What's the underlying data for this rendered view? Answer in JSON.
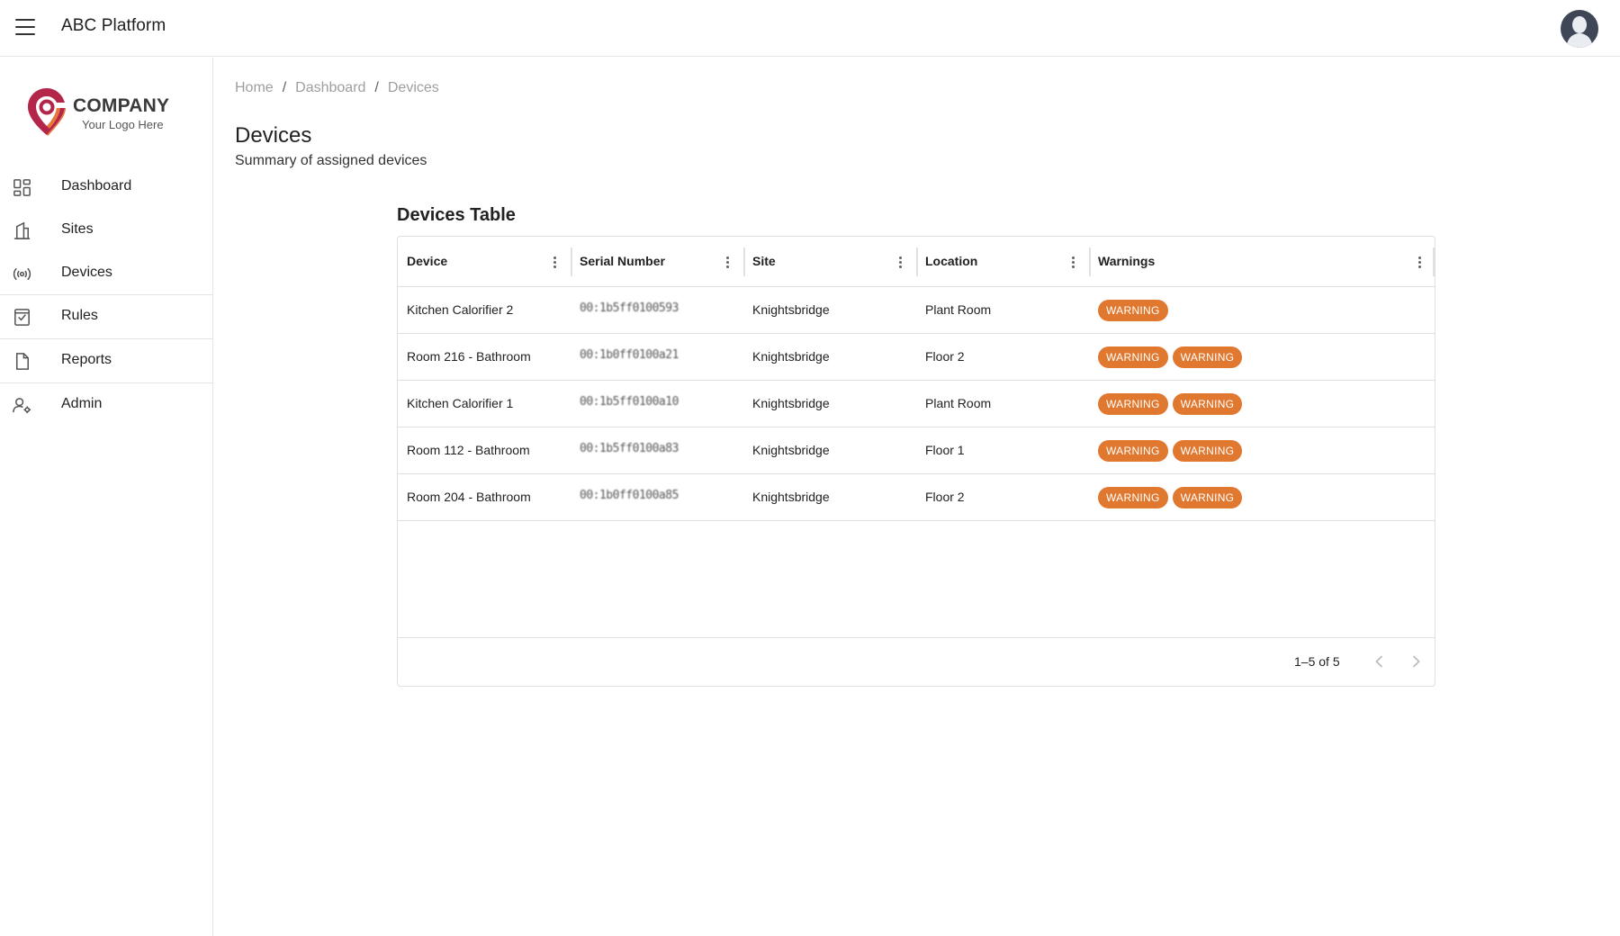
{
  "app": {
    "title": "ABC Platform",
    "menu_icon": "hamburger-menu-icon",
    "avatar_icon": "user-avatar-icon"
  },
  "logo": {
    "wordmark": "COMPANY",
    "tagline": "Your Logo Here",
    "colors": {
      "primary": "#b3264a",
      "secondary": "#e8773a"
    }
  },
  "sidebar": {
    "items": [
      {
        "label": "Dashboard",
        "icon": "dashboard-grid-icon"
      },
      {
        "label": "Sites",
        "icon": "building-icon"
      },
      {
        "label": "Devices",
        "icon": "broadcast-signal-icon"
      },
      {
        "label": "Rules",
        "icon": "checklist-icon"
      },
      {
        "label": "Reports",
        "icon": "document-icon"
      },
      {
        "label": "Admin",
        "icon": "user-settings-icon"
      }
    ]
  },
  "breadcrumb": {
    "items": [
      "Home",
      "Dashboard",
      "Devices"
    ],
    "separator": "/"
  },
  "page": {
    "title": "Devices",
    "subtitle": "Summary of assigned devices"
  },
  "table": {
    "title": "Devices Table",
    "columns": [
      "Device",
      "Serial Number",
      "Site",
      "Location",
      "Warnings"
    ],
    "column_menu_icon": "more-vertical-icon",
    "rows": [
      {
        "device": "Kitchen Calorifier 2",
        "serial": "00:1b5ff0100593",
        "site": "Knightsbridge",
        "location": "Plant Room",
        "warnings": [
          "WARNING"
        ]
      },
      {
        "device": "Room 216 - Bathroom",
        "serial": "00:1b0ff0100a21",
        "site": "Knightsbridge",
        "location": "Floor 2",
        "warnings": [
          "WARNING",
          "WARNING"
        ]
      },
      {
        "device": "Kitchen Calorifier 1",
        "serial": "00:1b5ff0100a10",
        "site": "Knightsbridge",
        "location": "Plant Room",
        "warnings": [
          "WARNING",
          "WARNING"
        ]
      },
      {
        "device": "Room 112 - Bathroom",
        "serial": "00:1b5ff0100a83",
        "site": "Knightsbridge",
        "location": "Floor 1",
        "warnings": [
          "WARNING",
          "WARNING"
        ]
      },
      {
        "device": "Room 204 - Bathroom",
        "serial": "00:1b0ff0100a85",
        "site": "Knightsbridge",
        "location": "Floor 2",
        "warnings": [
          "WARNING",
          "WARNING"
        ]
      }
    ],
    "pagination": {
      "label": "1–5 of 5",
      "prev_icon": "chevron-left-icon",
      "next_icon": "chevron-right-icon"
    },
    "colors": {
      "warning_badge": "#e0782f"
    }
  }
}
